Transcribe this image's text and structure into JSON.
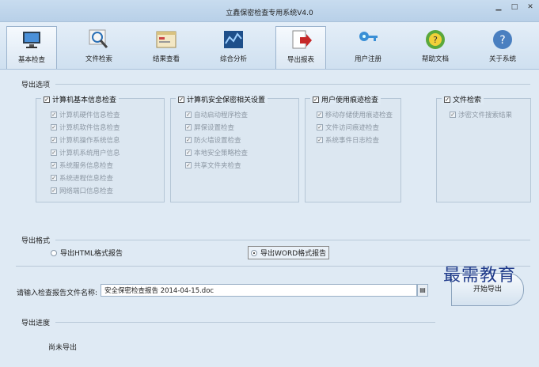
{
  "window": {
    "title": "立鑫保密检查专用系统V4.0",
    "controls": [
      "▁",
      "□",
      "✕"
    ]
  },
  "toolbar": [
    {
      "label": "基本检查",
      "icon": "computer-icon",
      "active": true
    },
    {
      "label": "文件检索",
      "icon": "magnifier-icon"
    },
    {
      "label": "结果查看",
      "icon": "window-icon"
    },
    {
      "label": "综合分析",
      "icon": "chart-icon"
    },
    {
      "label": "导出报表",
      "icon": "export-icon",
      "active_tab": true
    },
    {
      "label": "用户注册",
      "icon": "key-icon"
    },
    {
      "label": "帮助文档",
      "icon": "help-icon"
    },
    {
      "label": "关于系统",
      "icon": "question-icon"
    }
  ],
  "export_options": {
    "title": "导出选项",
    "groups": [
      {
        "title": "计算机基本信息检查",
        "checked": true,
        "items": [
          "计算机硬件信息检查",
          "计算机软件信息检查",
          "计算机操作系统信息",
          "计算机系统用户信息",
          "系统服务信息检查",
          "系统进程信息检查",
          "网络端口信息检查"
        ]
      },
      {
        "title": "计算机安全保密相关设置",
        "checked": true,
        "items": [
          "自动启动程序检查",
          "屏保设置检查",
          "防火墙设置检查",
          "本地安全策略检查",
          "共享文件夹检查"
        ]
      },
      {
        "title": "用户使用痕迹检查",
        "checked": true,
        "items": [
          "移动存储使用痕迹检查",
          "文件访问痕迹检查",
          "系统事件日志检查"
        ]
      },
      {
        "title": "文件检索",
        "checked": true,
        "items": [
          "涉密文件搜索结果"
        ]
      }
    ]
  },
  "export_format": {
    "title": "导出格式",
    "html_option": "导出HTML格式报告",
    "word_option": "导出WORD格式报告",
    "selected": "word"
  },
  "file": {
    "label": "请输入检查报告文件名称:",
    "value": "安全保密检查报告 2014-04-15.doc",
    "browse_icon": "folder-icon"
  },
  "start_button": "开始导出",
  "progress": {
    "title": "导出进度",
    "status": "尚未导出"
  },
  "watermark": "最需教育"
}
